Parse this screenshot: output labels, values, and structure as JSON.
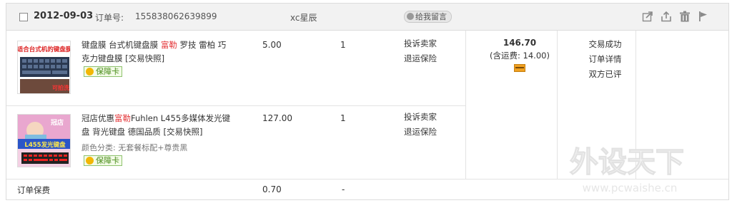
{
  "header": {
    "date": "2012-09-03",
    "order_no_label": "订单号:",
    "order_no": "155838062639899",
    "seller": "xc星辰",
    "message_button": "给我留言"
  },
  "items": [
    {
      "title_pre": "键盘膜 台式机键盘膜 ",
      "title_hl": "富勒",
      "title_post": " 罗技 雷柏 巧克力键盘膜 [交易快照]",
      "price": "5.00",
      "qty": "1",
      "actions": [
        "投诉卖家",
        "退运保险"
      ],
      "badge": "保障卡",
      "thumb_text_top": "适合台式机的键盘膜",
      "thumb_text_bottom": "可拍洗"
    },
    {
      "title_pre": "冠店优惠",
      "title_hl": "富勒",
      "title_post": "Fuhlen L455多媒体发光键盘 背光键盘 德国品质 [交易快照]",
      "sku": "颜色分类: 无套餐标配+尊贵黑",
      "price": "127.00",
      "qty": "1",
      "actions": [
        "投诉卖家",
        "退运保险"
      ],
      "badge": "保障卡",
      "thumb_text_top": "冠店",
      "thumb_text_mid": "L455发光键盘"
    }
  ],
  "totals": {
    "amount": "146.70",
    "shipping": "(含运费: 14.00)"
  },
  "status": [
    "交易成功",
    "订单详情",
    "双方已评"
  ],
  "footer": {
    "label": "订单保费",
    "value": "0.70",
    "dash": "-"
  },
  "watermark": {
    "big": "外设天下",
    "url": "www.pcwaishe.cn"
  },
  "colors": {
    "highlight": "#e4393c",
    "header_bg": "#f2f2f2",
    "badge_green": "#4b8d1c"
  }
}
